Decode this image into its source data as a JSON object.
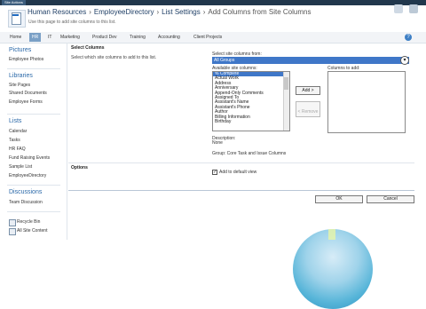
{
  "ribbon": {
    "site_actions": "Site Actions"
  },
  "header": {
    "breadcrumb": [
      "Human Resources",
      "EmployeeDirectory",
      "List Settings",
      "Add Columns from Site Columns"
    ],
    "subtitle": "Use this page to add site columns to this list."
  },
  "topnav": {
    "tabs": [
      "Home",
      "HR",
      "IT",
      "Marketing",
      "Product Dev",
      "Training",
      "Accounting",
      "Client Projects"
    ],
    "active": "HR"
  },
  "quicklaunch": {
    "pictures_heading": "Pictures",
    "pictures_items": [
      "Employee Photos"
    ],
    "libraries_heading": "Libraries",
    "libraries_items": [
      "Site Pages",
      "Shared Documents",
      "Employee Forms"
    ],
    "lists_heading": "Lists",
    "lists_items": [
      "Calendar",
      "Tasks",
      "HR FAQ",
      "Fund Raising Events",
      "Sample List",
      "EmployeeDirectory"
    ],
    "discussions_heading": "Discussions",
    "discussions_items": [
      "Team Discussion"
    ],
    "recycle_bin": "Recycle Bin",
    "all_site_content": "All Site Content"
  },
  "main": {
    "section1_title": "Select Columns",
    "section1_desc": "Select which site columns to add to this list.",
    "group_label": "Select site columns from:",
    "group_value": "All Groups",
    "available_label": "Available site columns:",
    "available": [
      "% Complete",
      "Actual Work",
      "Address",
      "Anniversary",
      "Append-Only Comments",
      "Assigned To",
      "Assistant's Name",
      "Assistant's Phone",
      "Author",
      "Billing Information",
      "Birthday"
    ],
    "selected_index": 0,
    "add_button": "Add >",
    "remove_button": "< Remove",
    "add_label": "Columns to add:",
    "description_label": "Description:",
    "description_value": "None",
    "group_info": "Group: Core Task and Issue Columns",
    "section2_title": "Options",
    "add_default_view": "Add to default view",
    "ok": "OK",
    "cancel": "Cancel"
  }
}
